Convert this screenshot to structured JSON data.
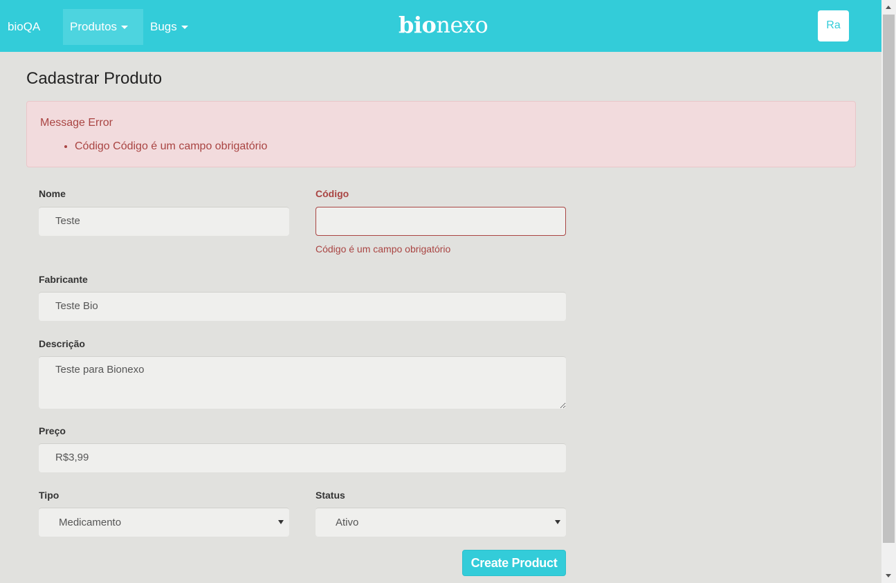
{
  "navbar": {
    "brand": "bioQA",
    "items": [
      {
        "label": "Produtos",
        "active": true
      },
      {
        "label": "Bugs",
        "active": false
      }
    ],
    "logo_bold": "bio",
    "logo_light": "nexo",
    "user_initials": "Ra"
  },
  "page": {
    "title": "Cadastrar Produto"
  },
  "alert": {
    "title": "Message Error",
    "messages": [
      "Código Código é um campo obrigatório"
    ]
  },
  "form": {
    "nome": {
      "label": "Nome",
      "value": "Teste"
    },
    "codigo": {
      "label": "Código",
      "value": "",
      "error": "Código é um campo obrigatório"
    },
    "fabricante": {
      "label": "Fabricante",
      "value": "Teste Bio"
    },
    "descricao": {
      "label": "Descrição",
      "value": "Teste para Bionexo"
    },
    "preco": {
      "label": "Preço",
      "value": "R$3,99"
    },
    "tipo": {
      "label": "Tipo",
      "selected": "Medicamento"
    },
    "status": {
      "label": "Status",
      "selected": "Ativo"
    },
    "submit_label": "Create Product"
  },
  "colors": {
    "accent": "#33ccd9",
    "error": "#a94442",
    "alert_bg": "#f2dbdd",
    "page_bg": "#e1e1de"
  }
}
